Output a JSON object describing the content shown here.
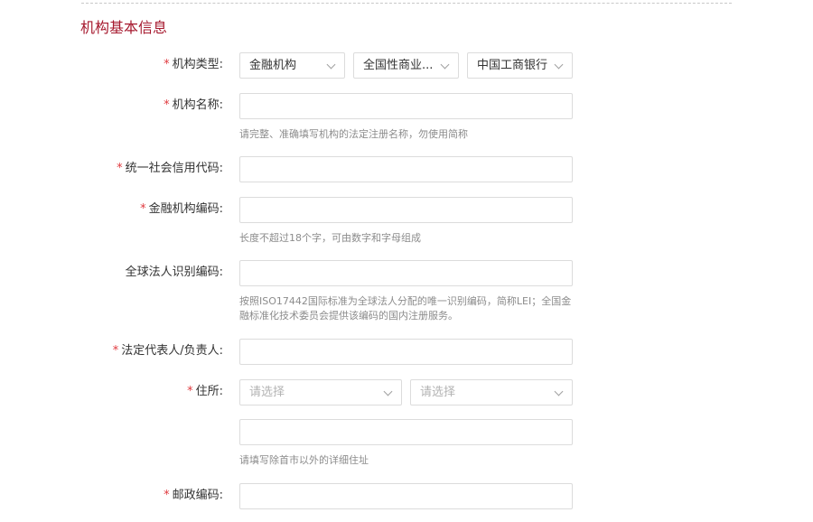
{
  "section": {
    "title": "机构基本信息"
  },
  "required_mark": "*",
  "colors": {
    "accent": "#a6192e",
    "required": "#e0393e",
    "hint": "#8c8c8c",
    "border": "#dcdcdc"
  },
  "fields": {
    "org_type": {
      "label": "机构类型:",
      "select1": "金融机构",
      "select2": "全国性商业...",
      "select3": "中国工商银行"
    },
    "org_name": {
      "label": "机构名称:",
      "value": "",
      "hint": "请完整、准确填写机构的法定注册名称，勿使用简称"
    },
    "credit_code": {
      "label": "统一社会信用代码:",
      "value": ""
    },
    "fin_code": {
      "label": "金融机构编码:",
      "value": "",
      "hint": "长度不超过18个字，可由数字和字母组成"
    },
    "lei": {
      "label": "全球法人识别编码:",
      "value": "",
      "hint_line1": "按照ISO17442国际标准为全球法人分配的唯一识别编码，简称LEI；全国金",
      "hint_line2": "融标准化技术委员会提供该编码的国内注册服务。"
    },
    "legal_rep": {
      "label": "法定代表人/负责人:",
      "value": ""
    },
    "address": {
      "label": "住所:",
      "select1_placeholder": "请选择",
      "select2_placeholder": "请选择",
      "detail_value": "",
      "hint": "请填写除首市以外的详细住址"
    },
    "postal": {
      "label": "邮政编码:",
      "value": ""
    }
  }
}
